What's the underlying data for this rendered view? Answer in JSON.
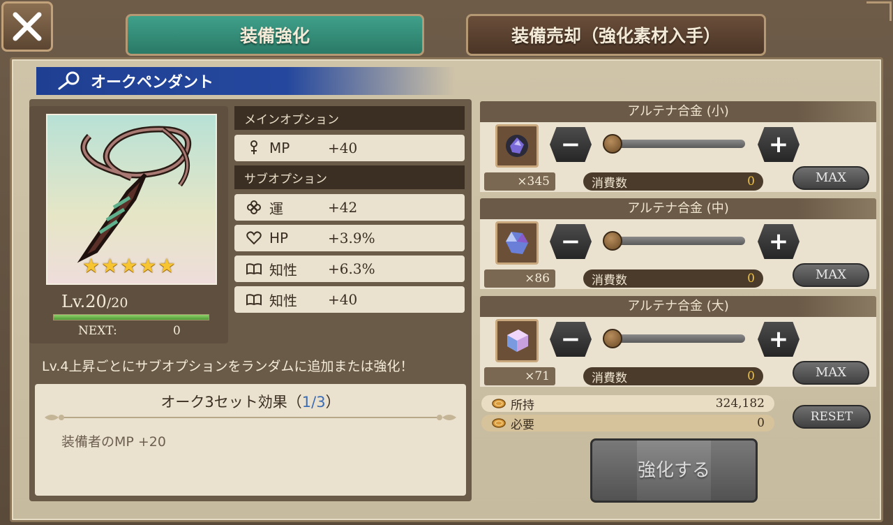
{
  "tabs": [
    {
      "label": "装備強化",
      "active": true
    },
    {
      "label": "装備売却（強化素材入手）",
      "active": false
    }
  ],
  "item": {
    "name": "オークペンダント",
    "rarity_stars": 5,
    "level": "Lv.20",
    "level_max": "/20",
    "xp_fill": 1.0,
    "next_label": "NEXT:",
    "next_value": "0"
  },
  "main_option": {
    "header": "メインオプション",
    "rows": [
      {
        "icon": "mp-icon",
        "name": "MP",
        "value": "+40"
      }
    ]
  },
  "sub_option": {
    "header": "サブオプション",
    "rows": [
      {
        "icon": "clover-icon",
        "name": "運",
        "value": "+42"
      },
      {
        "icon": "heart-icon",
        "name": "HP",
        "value": "+3.9%"
      },
      {
        "icon": "book-icon",
        "name": "知性",
        "value": "+6.3%"
      },
      {
        "icon": "book-icon",
        "name": "知性",
        "value": "+40"
      }
    ]
  },
  "hint": "Lv.4上昇ごとにサブオプションをランダムに追加または強化！",
  "set_bonus": {
    "title_prefix": "オーク3セット効果（",
    "count": "1/3",
    "title_suffix": "）",
    "effect": "装備者のMP +20"
  },
  "materials": [
    {
      "name": "アルテナ合金 (小)",
      "owned": "×345",
      "consume_label": "消費数",
      "consume_value": "0",
      "max_label": "MAX",
      "slider_level": 0,
      "color": "#6a5ad0"
    },
    {
      "name": "アルテナ合金 (中)",
      "owned": "×86",
      "consume_label": "消費数",
      "consume_value": "0",
      "max_label": "MAX",
      "slider_level": 0,
      "color": "#7a8fe0"
    },
    {
      "name": "アルテナ合金 (大)",
      "owned": "×71",
      "consume_label": "消費数",
      "consume_value": "0",
      "max_label": "MAX",
      "slider_level": 0,
      "color": "#c89ad8"
    }
  ],
  "money": {
    "owned_label": "所持",
    "owned_value": "324,182",
    "required_label": "必要",
    "required_value": "0"
  },
  "buttons": {
    "reset": "RESET",
    "enhance": "強化する",
    "minus": "−",
    "plus": "+"
  },
  "colors": {
    "tab_active": "#2f8a74",
    "tab_inactive": "#5a4030",
    "banner": "#1f3f92",
    "star": "#f7c531",
    "consume_value": "#f2c23b"
  }
}
